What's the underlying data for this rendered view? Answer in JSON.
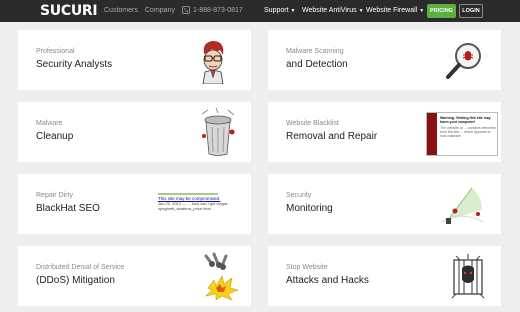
{
  "header": {
    "logo": "SUCURI",
    "nav": [
      {
        "label": "Customers"
      },
      {
        "label": "Company"
      }
    ],
    "phone": "1-888-873-0817",
    "menus": [
      {
        "label": "Support"
      },
      {
        "label": "Website AntiVirus"
      },
      {
        "label": "Website Firewall"
      }
    ],
    "pricing_label": "PRICING",
    "login_label": "LOGIN"
  },
  "cards": [
    {
      "sub": "Professional",
      "title": "Security Analysts",
      "icon": "analyst-icon"
    },
    {
      "sub": "Malware Scanning",
      "title": "and Detection",
      "icon": "magnifier-icon"
    },
    {
      "sub": "Malware",
      "title": "Cleanup",
      "icon": "trash-can-icon"
    },
    {
      "sub": "Website Blacklist",
      "title": "Removal and Repair",
      "icon": "blacklist-screenshot-icon"
    },
    {
      "sub": "Repair Dirty",
      "title": "BlackHat SEO",
      "icon": "seo-snippet-icon"
    },
    {
      "sub": "Security",
      "title": "Monitoring",
      "icon": "radar-icon"
    },
    {
      "sub": "Distributed Denial of Service",
      "title": "(DDoS) Mitigation",
      "icon": "explosion-icon"
    },
    {
      "sub": "Stop Website",
      "title": "Attacks and Hacks",
      "icon": "cage-icon"
    }
  ],
  "blacklist_shot": {
    "heading": "Warning: Visiting this site may harm your computer!",
    "body": "The website at ... contains elements from the site ... which appears to host malware"
  },
  "seo_snippet": {
    "link": "This site may be compromised.",
    "line1": "Jun 20, 2012 — ... how can i get viagra",
    "line2": "spaghetti_strattera_price.html"
  },
  "colors": {
    "header_bg": "#2b2b2b",
    "pricing_bg": "#5bb13f",
    "page_bg": "#eeeeee",
    "card_bg": "#ffffff"
  }
}
